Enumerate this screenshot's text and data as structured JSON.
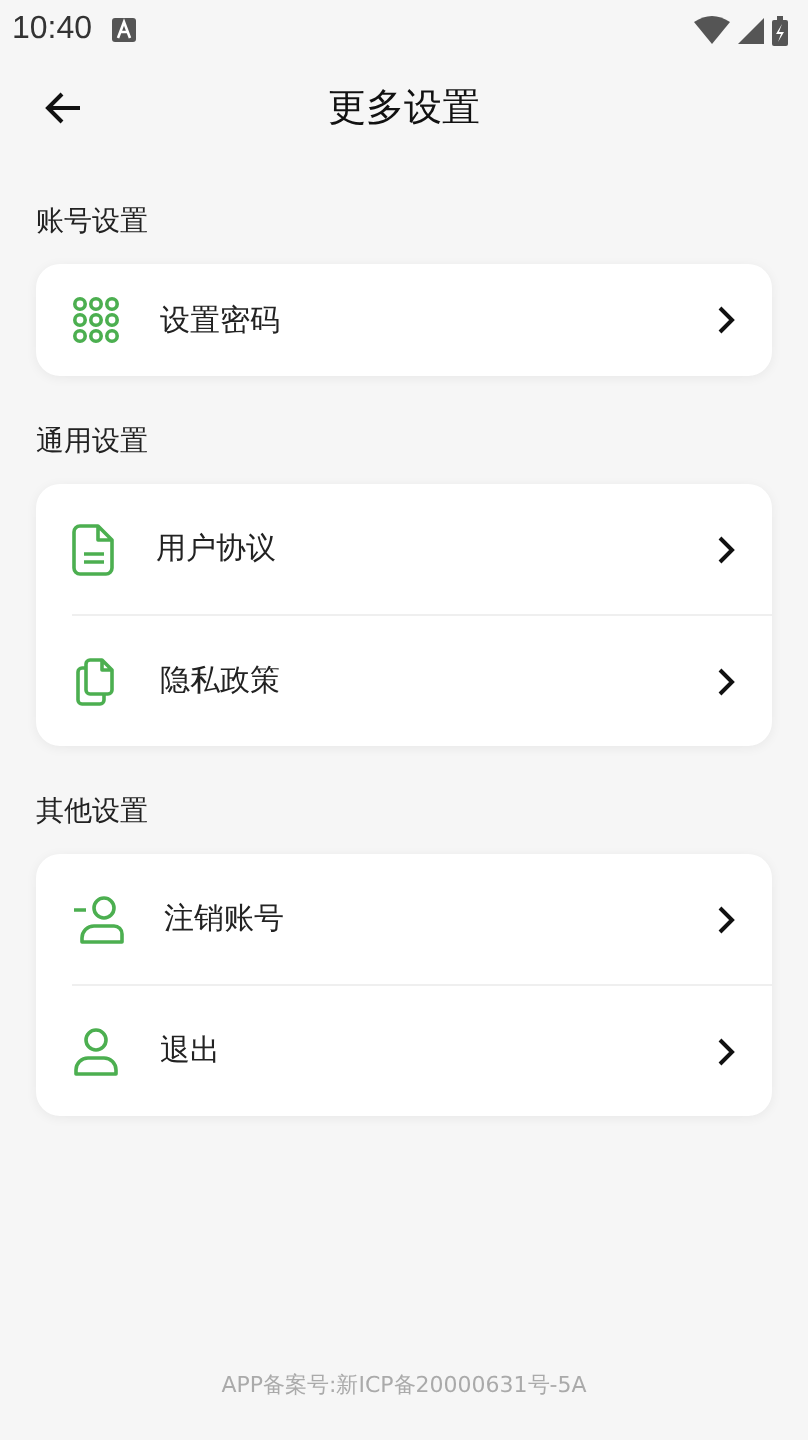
{
  "status_bar": {
    "time": "10:40"
  },
  "header": {
    "title": "更多设置"
  },
  "sections": [
    {
      "title": "账号设置",
      "items": [
        {
          "label": "设置密码",
          "kind": "keypad"
        }
      ]
    },
    {
      "title": "通用设置",
      "items": [
        {
          "label": "用户协议",
          "kind": "document"
        },
        {
          "label": "隐私政策",
          "kind": "documents"
        }
      ]
    },
    {
      "title": "其他设置",
      "items": [
        {
          "label": "注销账号",
          "kind": "unregister"
        },
        {
          "label": "退出",
          "kind": "logout"
        }
      ]
    }
  ],
  "footer": {
    "text": "APP备案号:新ICP备20000631号-5A"
  }
}
